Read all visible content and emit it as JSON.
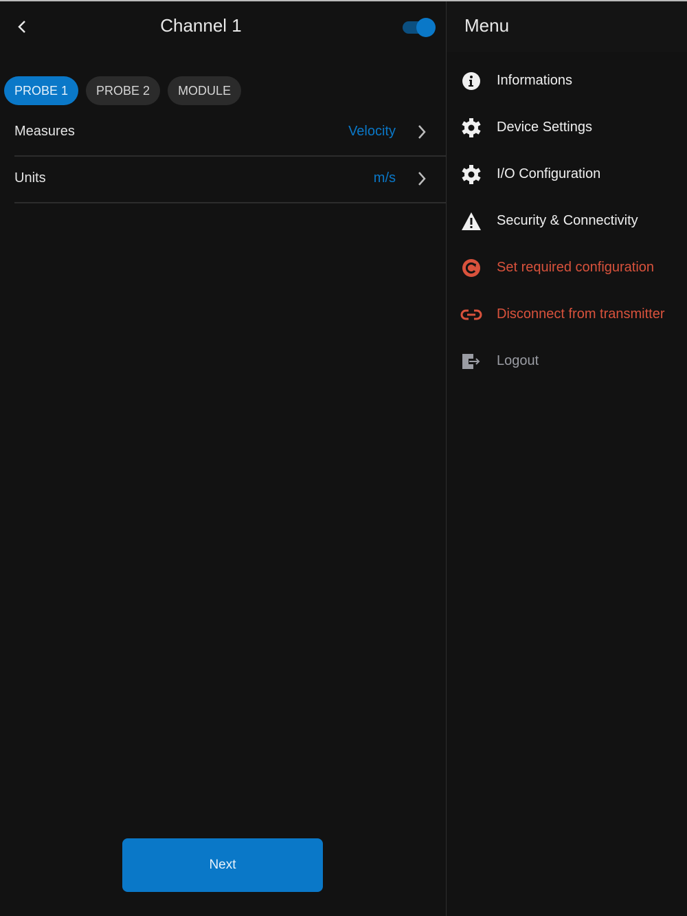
{
  "header": {
    "title": "Channel 1",
    "toggle_on": true
  },
  "tabs": [
    {
      "label": "PROBE 1",
      "active": true
    },
    {
      "label": "PROBE 2",
      "active": false
    },
    {
      "label": "MODULE",
      "active": false
    }
  ],
  "settings": [
    {
      "label": "Measures",
      "value": "Velocity"
    },
    {
      "label": "Units",
      "value": "m/s"
    }
  ],
  "next_label": "Next",
  "menu": {
    "title": "Menu",
    "items": [
      {
        "label": "Informations",
        "icon": "info-icon",
        "color": "#f0f0f0"
      },
      {
        "label": "Device Settings",
        "icon": "gear-icon",
        "color": "#f0f0f0"
      },
      {
        "label": "I/O Configuration",
        "icon": "gear-icon",
        "color": "#f0f0f0"
      },
      {
        "label": "Security & Connectivity",
        "icon": "warning-icon",
        "color": "#f0f0f0"
      },
      {
        "label": "Set required configuration",
        "icon": "reset-icon",
        "color": "#d9523c"
      },
      {
        "label": "Disconnect from transmitter",
        "icon": "link-icon",
        "color": "#d9523c"
      },
      {
        "label": "Logout",
        "icon": "logout-icon",
        "color": "#9a9ca3"
      }
    ]
  }
}
